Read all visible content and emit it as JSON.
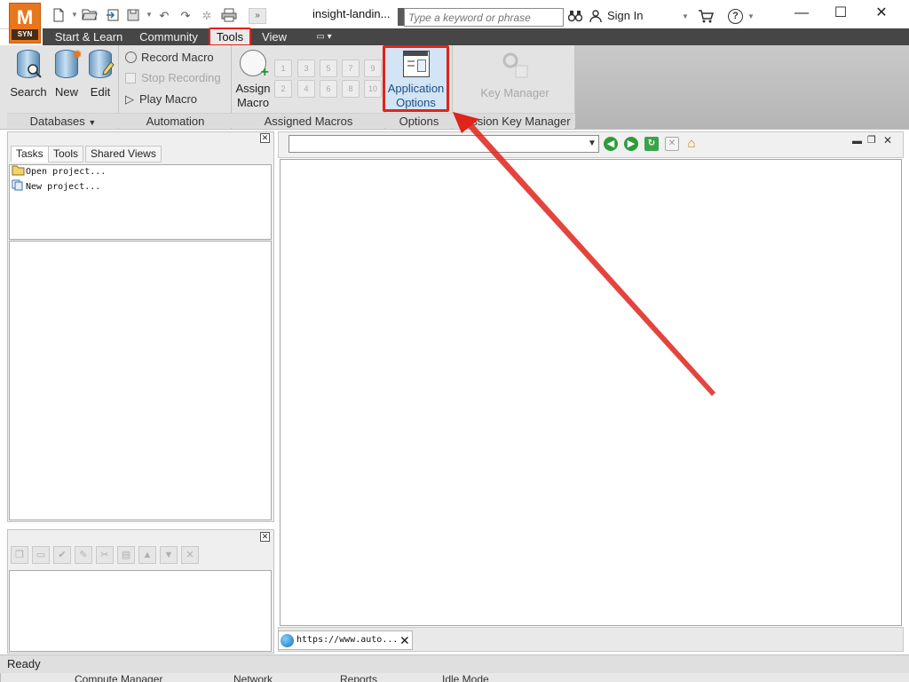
{
  "window": {
    "title": "insight-landin...",
    "minimize_glyph": "—",
    "maximize_glyph": "☐",
    "close_glyph": "✕"
  },
  "logo": {
    "letter": "M",
    "badge": "SYN"
  },
  "search": {
    "placeholder": "Type a keyword or phrase"
  },
  "account": {
    "sign_in_label": "Sign In",
    "help_glyph": "?"
  },
  "menu": {
    "tabs": [
      "Start & Learn",
      "Community",
      "Tools",
      "View"
    ],
    "active_tab": "Tools"
  },
  "ribbon": {
    "groups": {
      "databases": "Databases",
      "automation": "Automation",
      "assigned_macros": "Assigned Macros",
      "options": "Options",
      "session_key_manager": "Session Key Manager"
    },
    "databases": {
      "search": "Search",
      "new": "New",
      "edit": "Edit"
    },
    "automation": {
      "record": "Record Macro",
      "stop": "Stop Recording",
      "play": "Play Macro"
    },
    "assign_macro": {
      "line1": "Assign",
      "line2": "Macro"
    },
    "macro_slots": [
      "1",
      "3",
      "5",
      "7",
      "9",
      "2",
      "4",
      "6",
      "8",
      "10"
    ],
    "app_options": {
      "line1": "Application",
      "line2": "Options"
    },
    "key_manager": "Key Manager"
  },
  "left_pane": {
    "tabs": [
      "Tasks",
      "Tools",
      "Shared Views"
    ],
    "active_tab": "Tasks",
    "tasks": [
      "Open project...",
      "New project..."
    ]
  },
  "browser": {
    "address_value": "",
    "doc_tab_label": "https://www.auto..."
  },
  "status": {
    "text": "Ready"
  },
  "background_tabs": [
    "Compute Manager",
    "Network",
    "Reports",
    "Idle Mode"
  ],
  "colors": {
    "accent_highlight": "#e0231b",
    "logo_orange": "#e8761d",
    "menubar": "#464646"
  }
}
